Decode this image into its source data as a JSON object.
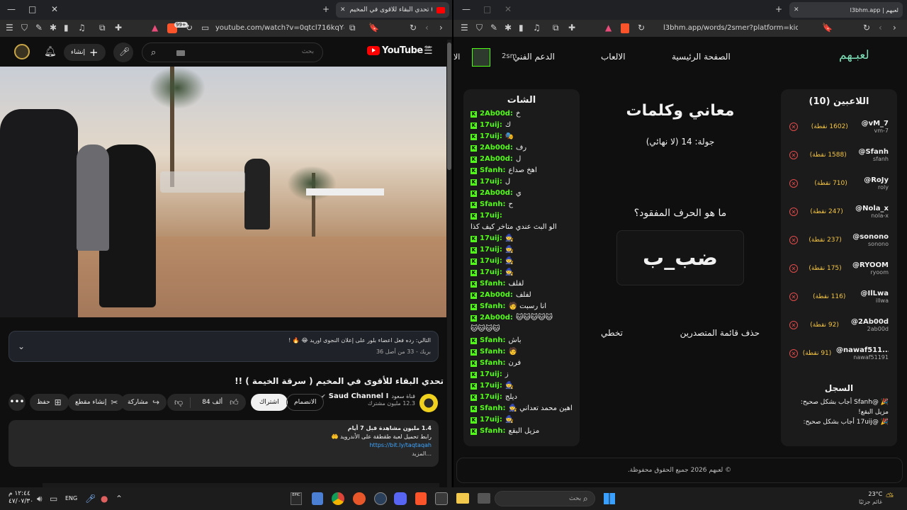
{
  "left_window": {
    "tab_title": "تحدي البقاء للأقوى في المخيم (...",
    "url": "youtube.com/watch?v=0qtcl716kqY&list=...",
    "badge": "99+",
    "youtube": {
      "logo": "YouTube",
      "region": "SA",
      "search_placeholder": "بحث",
      "create_label": "إنشاء",
      "notice_text": "التالي: رده فعل اعضاء بلور على إعلان النجوى اوريد 😂 🔥 !",
      "notice_meta": "بريك - 33 من أصل 36",
      "video_title": "تحدي البقاء للأقوى في المخيم ( سرقة الخيمة ) !!",
      "channel_name": "Saud Channel I",
      "channel_prefix": "قناة سعود",
      "subscribers": "12.3 مليون مشترك",
      "join_label": "الانضمام",
      "subscribe_label": "اشتراك",
      "likes": "84 ألف",
      "share_label": "مشاركة",
      "clip_label": "إنشاء مقطع",
      "save_label": "حفظ",
      "desc_views": "1.4 مليون مشاهدة قبل 7 أيام",
      "desc_line": "رابط تحميل لعبة طقطقة على الأندرويد 🤲",
      "desc_link": "https://bit.ly/taqtaqah",
      "desc_more": "...المزيد"
    }
  },
  "right_window": {
    "tab_title": "l3bhm.app | لعبهم",
    "url": "l3bhm.app/words/2smer?platform=kick",
    "site": {
      "logo": "لعبـهم",
      "nav": [
        "الصفحة الرئيسية",
        "الالعاب",
        "الدعم الفني"
      ],
      "user": "2sm",
      "cut_text": "الا",
      "players_title": "اللاعبين (10)",
      "players": [
        {
          "handle": "@vM_7",
          "name": "vm-7",
          "points": "(1602 نقطة)"
        },
        {
          "handle": "@Sfanh",
          "name": "sfanh",
          "points": "(1588 نقطة)"
        },
        {
          "handle": "@RoJy",
          "name": "roly",
          "points": "(710 نقطة)"
        },
        {
          "handle": "@Nola_x",
          "name": "nola-x",
          "points": "(247 نقطة)"
        },
        {
          "handle": "@sonono",
          "name": "sonono",
          "points": "(237 نقطة)"
        },
        {
          "handle": "@RYOOM",
          "name": "ryoom",
          "points": "(175 نقطة)"
        },
        {
          "handle": "@IlLwa",
          "name": "illwa",
          "points": "(116 نقطة)"
        },
        {
          "handle": "@2Ab00d",
          "name": "2ab00d",
          "points": "(92 نقطة)"
        },
        {
          "handle": "@nawaf511...",
          "name": "nawaf51191",
          "points": "(91 نقطة)"
        }
      ],
      "log_title": "السجل",
      "log": [
        "🎉 @Sfanh أجاب بشكل صحيح: مزيل البقع!",
        "🎉 @17uij أجاب بشكل صحيح:"
      ],
      "game_title": "معاني وكلمات",
      "round": "جولة: 14 (لا نهائي)",
      "question": "ما هو الحرف المفقود؟",
      "word": "ضب_ب",
      "clear_label": "حذف قائمة المتصدرين",
      "skip_label": "تخطي",
      "chat_title": "الشات",
      "chat": [
        {
          "user": "2Ab00d:",
          "msg": "خ"
        },
        {
          "user": "17uij:",
          "msg": "ك"
        },
        {
          "user": "17uij:",
          "msg": "🎭"
        },
        {
          "user": "2Ab00d:",
          "msg": "رف"
        },
        {
          "user": "2Ab00d:",
          "msg": "ل"
        },
        {
          "user": "Sfanh:",
          "msg": "اهخ صداع"
        },
        {
          "user": "17uij:",
          "msg": "ل"
        },
        {
          "user": "2Ab00d:",
          "msg": "ي"
        },
        {
          "user": "Sfanh:",
          "msg": "ح"
        },
        {
          "user": "17uij:",
          "msg": ""
        },
        {
          "user": "",
          "msg": "الو البث عندي متاخر كيف كذا"
        },
        {
          "user": "17uij:",
          "msg": "🧙"
        },
        {
          "user": "17uij:",
          "msg": "🧙"
        },
        {
          "user": "17uij:",
          "msg": "🧙"
        },
        {
          "user": "17uij:",
          "msg": "🧙"
        },
        {
          "user": "Sfanh:",
          "msg": "لفلف"
        },
        {
          "user": "2Ab00d:",
          "msg": "لفلف"
        },
        {
          "user": "Sfanh:",
          "msg": "انا رسبت 🧑"
        },
        {
          "user": "2Ab00d:",
          "msg": "🐱🐱🐱🐱🐱"
        },
        {
          "user": "",
          "msg": "🐱🐱🐱🐱"
        },
        {
          "user": "Sfanh:",
          "msg": "باش"
        },
        {
          "user": "Sfanh:",
          "msg": "🧑"
        },
        {
          "user": "Sfanh:",
          "msg": "فرن"
        },
        {
          "user": "17uij:",
          "msg": "ز"
        },
        {
          "user": "17uij:",
          "msg": "🧙"
        },
        {
          "user": "17uij:",
          "msg": "ديلج"
        },
        {
          "user": "Sfanh:",
          "msg": "اهين محمد تعداني 🧙"
        },
        {
          "user": "17uij:",
          "msg": "🧙"
        },
        {
          "user": "Sfanh:",
          "msg": "مزيل البقع"
        }
      ],
      "footer": "© لعبهم 2026 جميع الحقوق محفوظة."
    }
  },
  "taskbar": {
    "time": "١٢:٤٤ م",
    "date": "٤٧/٠٧/٣٠",
    "lang": "ENG",
    "search_placeholder": "بحث",
    "weather_temp": "23°C",
    "weather_desc": "غائم جزئيًا"
  }
}
